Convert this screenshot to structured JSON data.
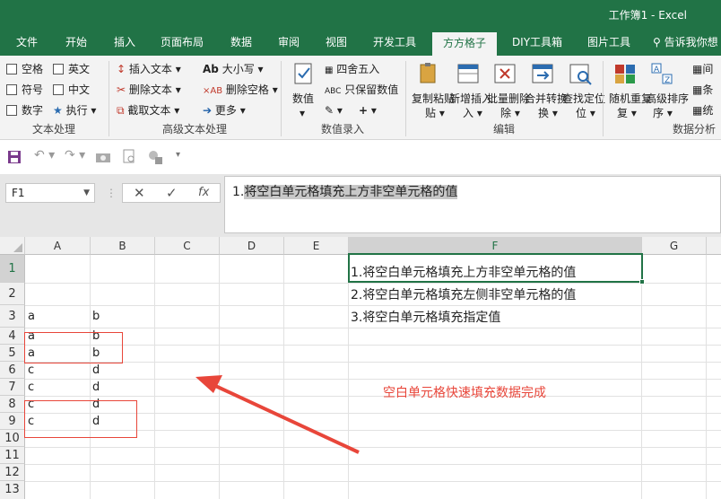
{
  "window": {
    "title": "工作簿1 - Excel"
  },
  "tabs": [
    "文件",
    "开始",
    "插入",
    "页面布局",
    "数据",
    "审阅",
    "视图",
    "开发工具",
    "方方格子",
    "DIY工具箱",
    "图片工具",
    "告诉我你想"
  ],
  "active_tab": "方方格子",
  "ribbon": {
    "text_processing": {
      "items": [
        "空格",
        "英文",
        "符号",
        "中文",
        "数字",
        "执行"
      ],
      "group_label": "文本处理"
    },
    "advanced_text": {
      "items": [
        "插入文本",
        "删除文本",
        "截取文本",
        "大小写",
        "删除空格",
        "更多"
      ],
      "group_label": "高级文本处理"
    },
    "numeric_entry": {
      "big_button": "数值",
      "items": [
        "四舍五入",
        "只保留数值"
      ],
      "group_label": "数值录入"
    },
    "edit": {
      "buttons": [
        "复制粘贴",
        "新增插入",
        "批量删除",
        "合并转换",
        "查找定位"
      ],
      "group_label": "编辑"
    },
    "data_analysis": {
      "buttons": [
        "随机重复",
        "高级排序"
      ],
      "partial": [
        "间",
        "条",
        "统"
      ],
      "group_label": "数据分析"
    }
  },
  "formula_bar": {
    "name_box": "F1",
    "content_prefix": "1.",
    "content_selected": "将空白单元格填充上方非空单元格的值"
  },
  "sheet": {
    "columns": [
      "A",
      "B",
      "C",
      "D",
      "E",
      "F",
      "G"
    ],
    "active_column": "F",
    "rows": [
      "1",
      "2",
      "3",
      "4",
      "5",
      "6",
      "7",
      "8",
      "9",
      "10",
      "11",
      "12",
      "13"
    ],
    "active_row": "1",
    "cells_a": [
      "a",
      "a",
      "a",
      "c",
      "c",
      "c",
      "c"
    ],
    "cells_b": [
      "b",
      "b",
      "b",
      "d",
      "d",
      "d",
      "d"
    ],
    "f_lines": [
      "1.将空白单元格填充上方非空单元格的值",
      "2.将空白单元格填充左侧非空单元格的值",
      "3.将空白单元格填充指定值"
    ],
    "annotation": "空白单元格快速填充数据完成"
  },
  "colors": {
    "excel_green": "#217346",
    "annotation_red": "#e8463a"
  }
}
